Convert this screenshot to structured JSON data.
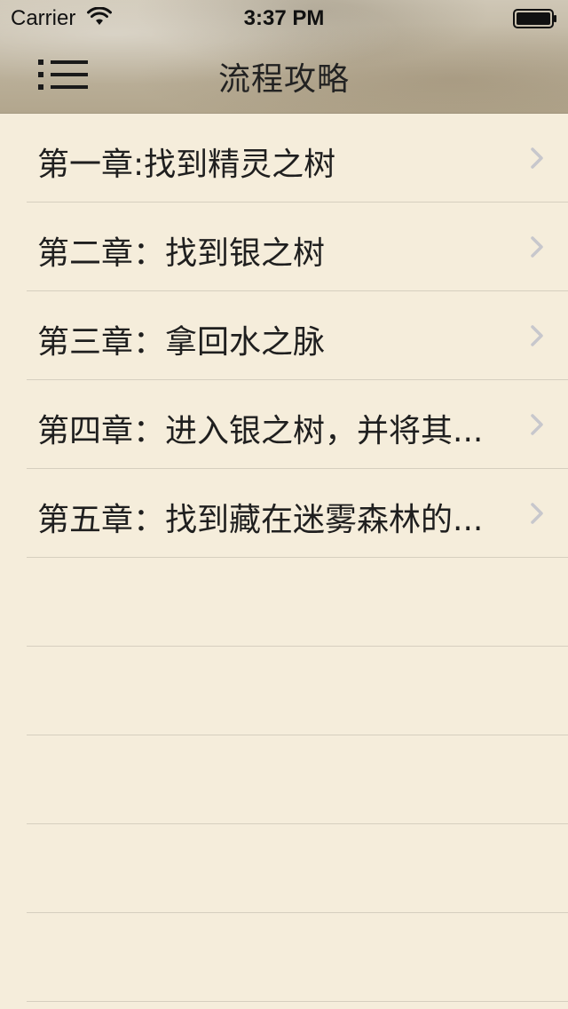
{
  "status_bar": {
    "carrier": "Carrier",
    "time": "3:37 PM",
    "wifi_icon": "wifi-icon",
    "battery_icon": "battery-icon"
  },
  "nav": {
    "title": "流程攻略",
    "menu_icon": "list-menu-icon"
  },
  "list": {
    "items": [
      {
        "label": "第一章:找到精灵之树",
        "icon": "chevron-right-icon"
      },
      {
        "label": "第二章：找到银之树",
        "icon": "chevron-right-icon"
      },
      {
        "label": "第三章：拿回水之脉",
        "icon": "chevron-right-icon"
      },
      {
        "label": "第四章：进入银之树，并将其...",
        "icon": "chevron-right-icon"
      },
      {
        "label": "第五章：找到藏在迷雾森林的...",
        "icon": "chevron-right-icon"
      },
      {
        "label": ""
      },
      {
        "label": ""
      },
      {
        "label": ""
      },
      {
        "label": ""
      },
      {
        "label": ""
      }
    ]
  },
  "colors": {
    "background": "#f5eddb",
    "separator": "#d6cfbf",
    "text": "#222222",
    "chevron": "#c7c7cc"
  }
}
